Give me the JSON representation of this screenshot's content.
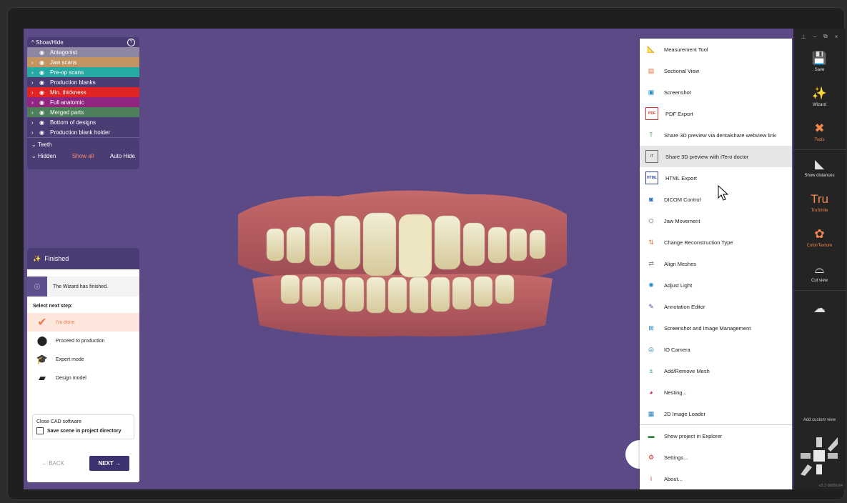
{
  "show_hide": {
    "title": "Show/Hide",
    "help_icon": "help-circle-icon",
    "rows": [
      {
        "label": "Antagonist",
        "color": "#8e87a4",
        "chevron": false
      },
      {
        "label": "Jaw scans",
        "color": "#c29462",
        "chevron": true
      },
      {
        "label": "Pre-op scans",
        "color": "#27a9a3",
        "chevron": true
      },
      {
        "label": "Production blanks",
        "color": "#4a3d74",
        "chevron": true
      },
      {
        "label": "Min. thickness",
        "color": "#e02424",
        "chevron": true
      },
      {
        "label": "Full anatomic",
        "color": "#92257f",
        "chevron": true
      },
      {
        "label": "Merged parts",
        "color": "#4d7f5a",
        "chevron": true
      },
      {
        "label": "Bottom of designs",
        "color": "#4a3d74",
        "chevron": true
      },
      {
        "label": "Production blank holder",
        "color": "#4a3d74",
        "chevron": true
      }
    ],
    "teeth": "Teeth",
    "hidden": "Hidden",
    "show_all": "Show all",
    "auto_hide": "Auto Hide"
  },
  "wizard": {
    "title": "Finished",
    "info": "The Wizard has finished.",
    "select_next": "Select next step:",
    "options": [
      {
        "label": "I'm done",
        "icon": "checkmark-icon",
        "active": true
      },
      {
        "label": "Proceed to production",
        "icon": "production-icon",
        "active": false
      },
      {
        "label": "Expert mode",
        "icon": "graduation-cap-icon",
        "active": false
      },
      {
        "label": "Design model",
        "icon": "design-model-icon",
        "active": false
      }
    ],
    "close_cad": "Close CAD software",
    "save_scene": "Save scene in project directory",
    "back": "← BACK",
    "next": "NEXT →"
  },
  "tools_menu": {
    "items": [
      {
        "label": "Measurement Tool",
        "icon": "ruler-icon"
      },
      {
        "label": "Sectional View",
        "icon": "section-icon"
      },
      {
        "label": "Screenshot",
        "icon": "screenshot-icon"
      },
      {
        "label": "PDF Export",
        "icon": "pdf-icon"
      },
      {
        "label": "Share 3D preview via dentalshare webview link",
        "icon": "upload-icon"
      },
      {
        "label": "Share 3D preview with iTero doctor",
        "icon": "itero-icon"
      },
      {
        "label": "HTML Export",
        "icon": "html-icon"
      },
      {
        "label": "DICOM Control",
        "icon": "dicom-icon"
      },
      {
        "label": "Jaw Movement",
        "icon": "jaw-icon"
      },
      {
        "label": "Change Reconstruction Type",
        "icon": "reconstruction-icon"
      },
      {
        "label": "Align Meshes",
        "icon": "align-icon"
      },
      {
        "label": "Adjust Light",
        "icon": "light-icon"
      },
      {
        "label": "Annotation Editor",
        "icon": "annotation-icon"
      },
      {
        "label": "Screenshot and Image Management",
        "icon": "image-management-icon"
      },
      {
        "label": "IO Camera",
        "icon": "camera-icon"
      },
      {
        "label": "Add/Remove Mesh",
        "icon": "mesh-icon"
      },
      {
        "label": "Nesting...",
        "icon": "nesting-icon"
      },
      {
        "label": "2D Image Loader",
        "icon": "image-loader-icon"
      },
      {
        "label": "Show project in Explorer",
        "icon": "folder-icon"
      },
      {
        "label": "Settings...",
        "icon": "settings-icon"
      },
      {
        "label": "About...",
        "icon": "info-icon"
      }
    ],
    "pdf_text": "PDF",
    "html_text": "HTML",
    "itero_text": "iTero"
  },
  "sidebar": {
    "buttons": [
      {
        "label": "Save",
        "icon": "save-icon",
        "glyph": "💾"
      },
      {
        "label": "Wizard",
        "icon": "wand-icon",
        "glyph": "✨"
      },
      {
        "label": "Tools",
        "icon": "tools-icon",
        "glyph": "✖",
        "active": true
      },
      {
        "label": "Show distances",
        "icon": "distances-icon",
        "glyph": "◣"
      },
      {
        "label": "TruSmile",
        "icon": "trusmile-icon",
        "glyph": "Tru",
        "accent": true
      },
      {
        "label": "Color/Texture",
        "icon": "color-texture-icon",
        "glyph": "✿",
        "accent": true
      },
      {
        "label": "Cut view",
        "icon": "cut-view-icon",
        "glyph": "⌓"
      },
      {
        "label": "",
        "icon": "cloud-icon",
        "glyph": "☁"
      }
    ],
    "add_custom_view": "Add custom view",
    "version": "v3.2-8689c64"
  },
  "colors": {
    "viewport": "#5b4a86",
    "accent": "#f5874d",
    "panel": "#4a3d74"
  }
}
